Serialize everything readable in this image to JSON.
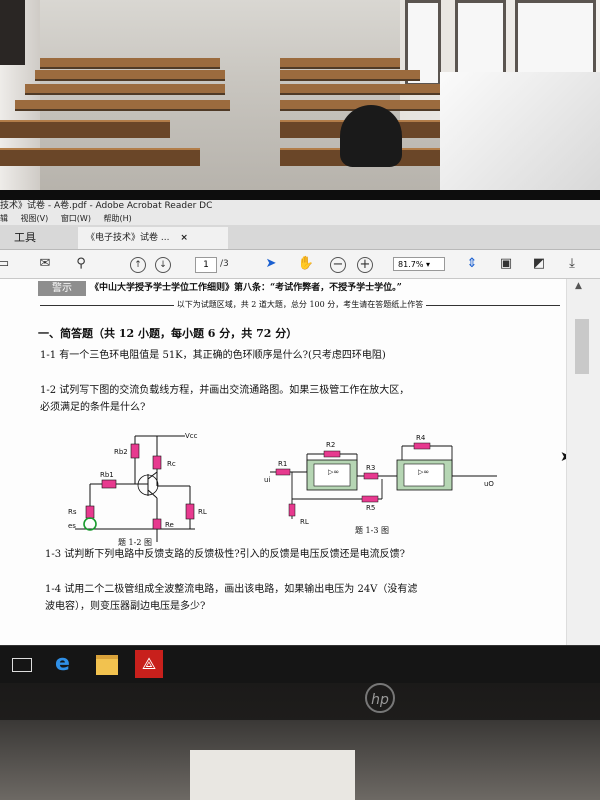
{
  "window": {
    "title": "技术》试卷 - A卷.pdf - Adobe Acrobat Reader DC",
    "menu": [
      "辑",
      "视图(V)",
      "窗口(W)",
      "帮助(H)"
    ]
  },
  "tabs": {
    "tools": "工具",
    "document": "《电子技术》试卷 ...",
    "close": "×"
  },
  "toolbar": {
    "page_current": "1",
    "page_total": "/3",
    "zoom": "81.7%"
  },
  "document": {
    "warning_label": "警示",
    "warning_text": "《中山大学授予学士学位工作细则》第八条：“考试作弊者，不授予学士学位。”",
    "answer_area_note": "以下为试题区域，共 2 道大题，总分 100 分，考生请在答题纸上作答",
    "section1": "一、简答题（共 12 小题，每小题 6 分，共 72 分）",
    "q1": "1-1   有一个三色环电阻值是 51K，其正确的色环顺序是什么?(只考虑四环电阻)",
    "q2_line1": "1-2   试列写下图的交流负载线方程，并画出交流通路图。如果三极管工作在放大区，",
    "q2_line2": "必须满足的条件是什么?",
    "fig12_caption": "题 1-2 图",
    "fig13_caption": "题 1-3 图",
    "fig12_labels": {
      "vcc": "Vcc",
      "rb2": "Rb2",
      "rb1": "Rb1",
      "rc": "Rc",
      "rs": "Rs",
      "es": "es",
      "re": "Re",
      "rl": "RL"
    },
    "fig13_labels": {
      "r1": "R1",
      "r2": "R2",
      "r3": "R3",
      "r4": "R4",
      "r5": "R5",
      "rl": "RL",
      "inf": "▷∞",
      "ui": "ui",
      "uo": "uO"
    },
    "q3": "1-3   试判断下列电路中反馈支路的反馈极性?引入的反馈是电压反馈还是电流反馈?",
    "q4_line1": "1-4   试用二个二极管组成全波整流电路，画出该电路，如果输出电压为 24V（没有滤",
    "q4_line2": "波电容），则变压器副边电压是多少?"
  },
  "taskbar": {
    "icons": [
      "task-view-icon",
      "edge-icon",
      "file-explorer-icon",
      "acrobat-icon"
    ]
  },
  "bezel": {
    "logo": "hp"
  }
}
